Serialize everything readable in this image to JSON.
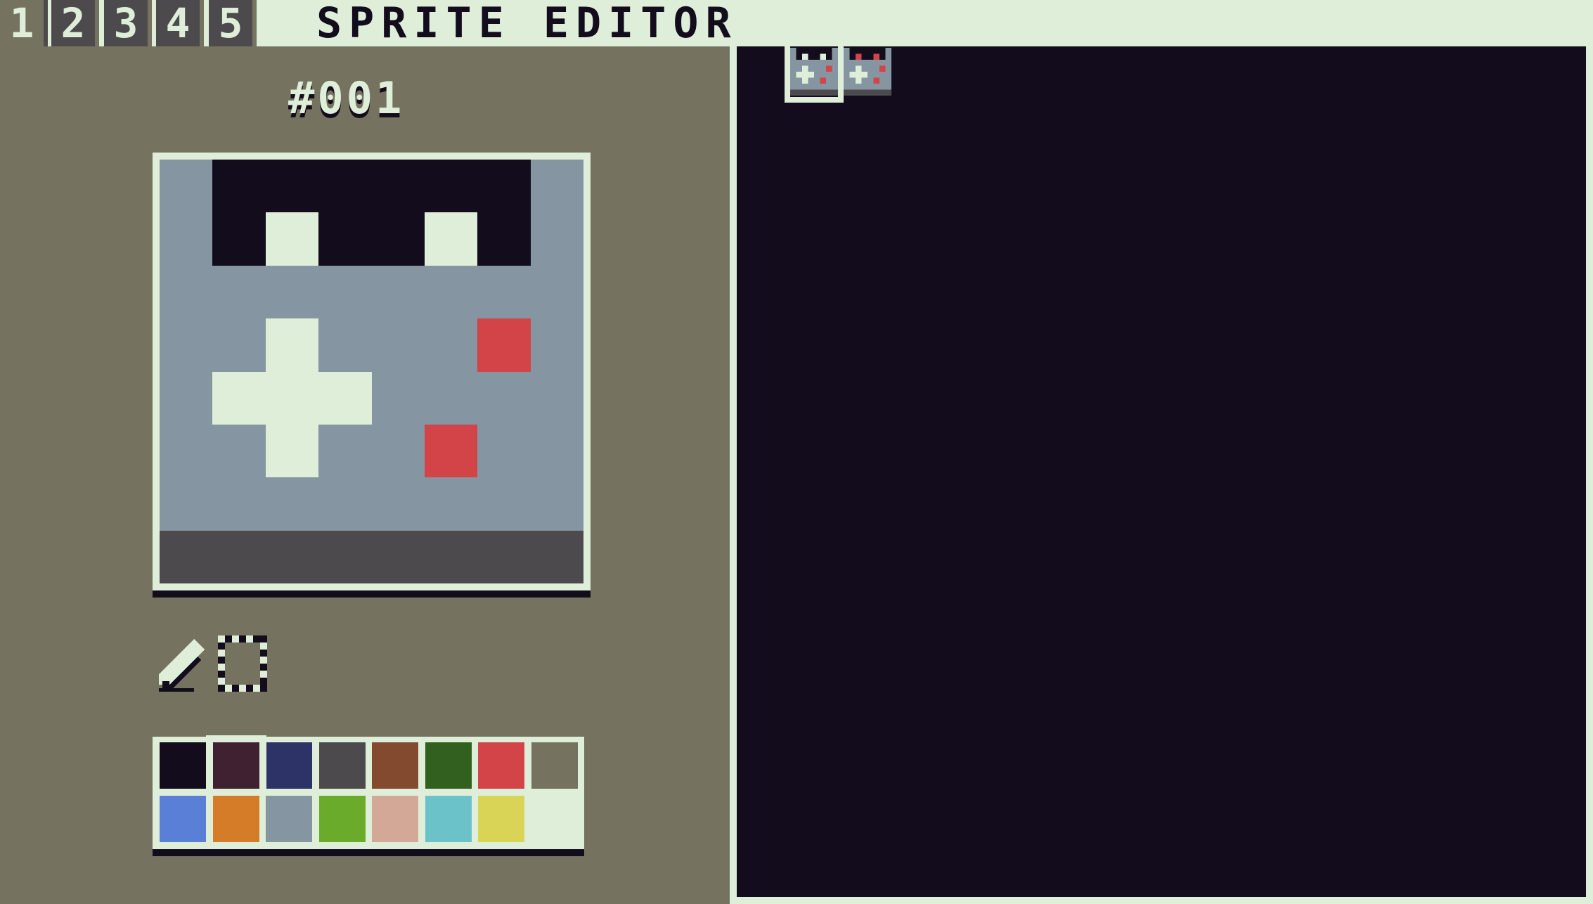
{
  "tabs": [
    {
      "label": "1",
      "active": true
    },
    {
      "label": "2",
      "active": false
    },
    {
      "label": "3",
      "active": false
    },
    {
      "label": "4",
      "active": false
    },
    {
      "label": "5",
      "active": false
    }
  ],
  "title": "SPRITE EDITOR",
  "sprite_number": "#001",
  "colors": {
    "bg": "#75735f",
    "light": "#dfeed9",
    "dark": "#120c1c",
    "gray": "#4d4a4d"
  },
  "palette": [
    "#120c1c",
    "#3f2132",
    "#2e3367",
    "#4d4a4d",
    "#834a2f",
    "#32601f",
    "#d24448",
    "#75735f",
    "#5a7fd6",
    "#d57c29",
    "#8595a1",
    "#6aab2b",
    "#d4a897",
    "#6cc2c9",
    "#dad456",
    "#dfeed9"
  ],
  "selected_color_index": 1,
  "sprite_pixels": [
    [
      10,
      0,
      0,
      0,
      0,
      0,
      0,
      10
    ],
    [
      10,
      0,
      15,
      0,
      0,
      15,
      0,
      10
    ],
    [
      10,
      10,
      10,
      10,
      10,
      10,
      10,
      10
    ],
    [
      10,
      10,
      15,
      10,
      10,
      10,
      6,
      10
    ],
    [
      10,
      15,
      15,
      15,
      10,
      10,
      10,
      10
    ],
    [
      10,
      10,
      15,
      10,
      10,
      6,
      10,
      10
    ],
    [
      10,
      10,
      10,
      10,
      10,
      10,
      10,
      10
    ],
    [
      3,
      3,
      3,
      3,
      3,
      3,
      3,
      3
    ]
  ],
  "tools": [
    {
      "name": "pencil-tool-icon",
      "selected": true
    },
    {
      "name": "select-tool-icon",
      "selected": false
    }
  ],
  "map_sprites": [
    {
      "name": "sprite-thumb-001",
      "selected": true
    },
    {
      "name": "sprite-thumb-002",
      "selected": false
    }
  ]
}
